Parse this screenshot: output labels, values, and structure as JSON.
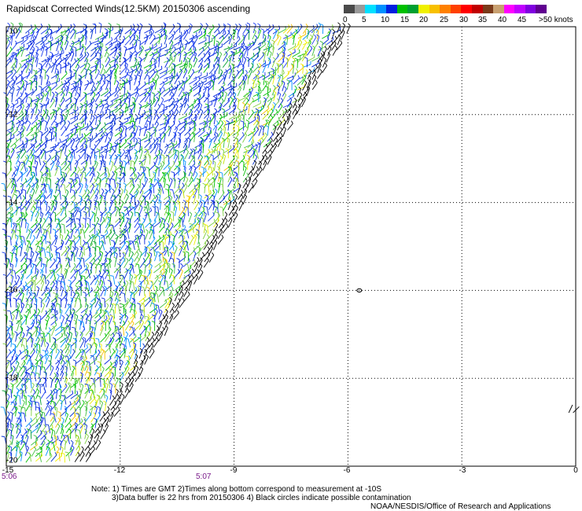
{
  "title": "Rapidscat Corrected Winds(12.5KM) 20150306 ascending",
  "legend": {
    "colors": [
      "#4a4a4a",
      "#9a9a9a",
      "#00e0ff",
      "#0090ff",
      "#0020e0",
      "#00c000",
      "#00a030",
      "#f0f000",
      "#f8c000",
      "#ff8000",
      "#ff4000",
      "#ff0000",
      "#c00000",
      "#7a3a1a",
      "#c8a070",
      "#ff00ff",
      "#c000ff",
      "#8000e0",
      "#600090"
    ],
    "labels": [
      "0",
      "5",
      "10",
      "15",
      "20",
      "25",
      "30",
      "35",
      "40",
      "45",
      ">50 knots"
    ]
  },
  "axes": {
    "x_ticks": [
      "-15",
      "-12",
      "-9",
      "-6",
      "-3",
      "0"
    ],
    "y_ticks": [
      "-10",
      "-12",
      "-14",
      "-16",
      "-18",
      "-20"
    ]
  },
  "times": {
    "left": "5:06",
    "mid": "5:07"
  },
  "notes": {
    "line1": "Note: 1) Times are GMT 2)Times along bottom correspond to measurement at -10S",
    "line2": "3)Data buffer is 22 hrs from 20150306 4) Black circles indicate possible contamination",
    "line3": "NOAA/NESDIS/Office of Research and Applications"
  },
  "map_region": {
    "lon_range": [
      -15,
      0
    ],
    "lat_range": [
      -20,
      -10
    ]
  }
}
